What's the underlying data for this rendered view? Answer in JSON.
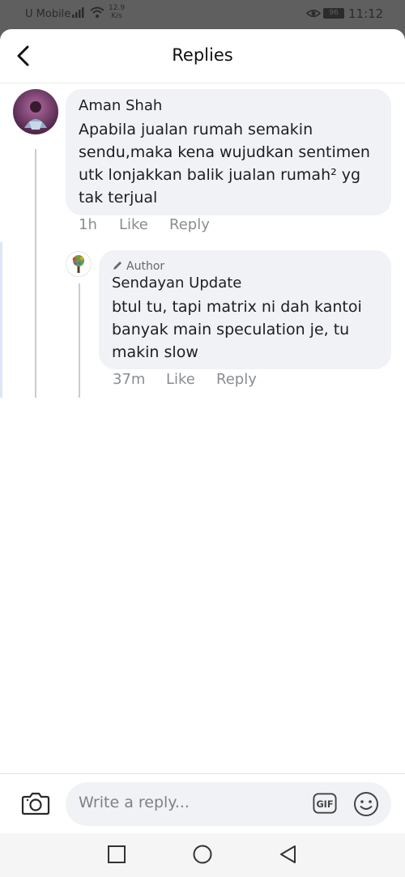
{
  "status_bar": {
    "carrier": "U Mobile",
    "speed_value": "12.9",
    "speed_unit": "K/s",
    "battery": "96",
    "time": "11:12"
  },
  "header": {
    "title": "Replies"
  },
  "comments": [
    {
      "author": "Aman Shah",
      "text": "Apabila jualan rumah semakin sendu,maka kena wujudkan sentimen utk lonjakkan balik jualan rumah² yg tak terjual",
      "time": "1h",
      "like": "Like",
      "reply": "Reply"
    },
    {
      "badge": "Author",
      "author": "Sendayan Update",
      "text": "btul tu, tapi matrix ni dah kantoi banyak main speculation je, tu makin slow",
      "time": "37m",
      "like": "Like",
      "reply": "Reply"
    }
  ],
  "composer": {
    "placeholder": "Write a reply...",
    "gif_label": "GIF"
  },
  "colors": {
    "bubble": "#f0f2f5",
    "meta_text": "#8a8d91",
    "status_bar": "#5f5f5f"
  }
}
